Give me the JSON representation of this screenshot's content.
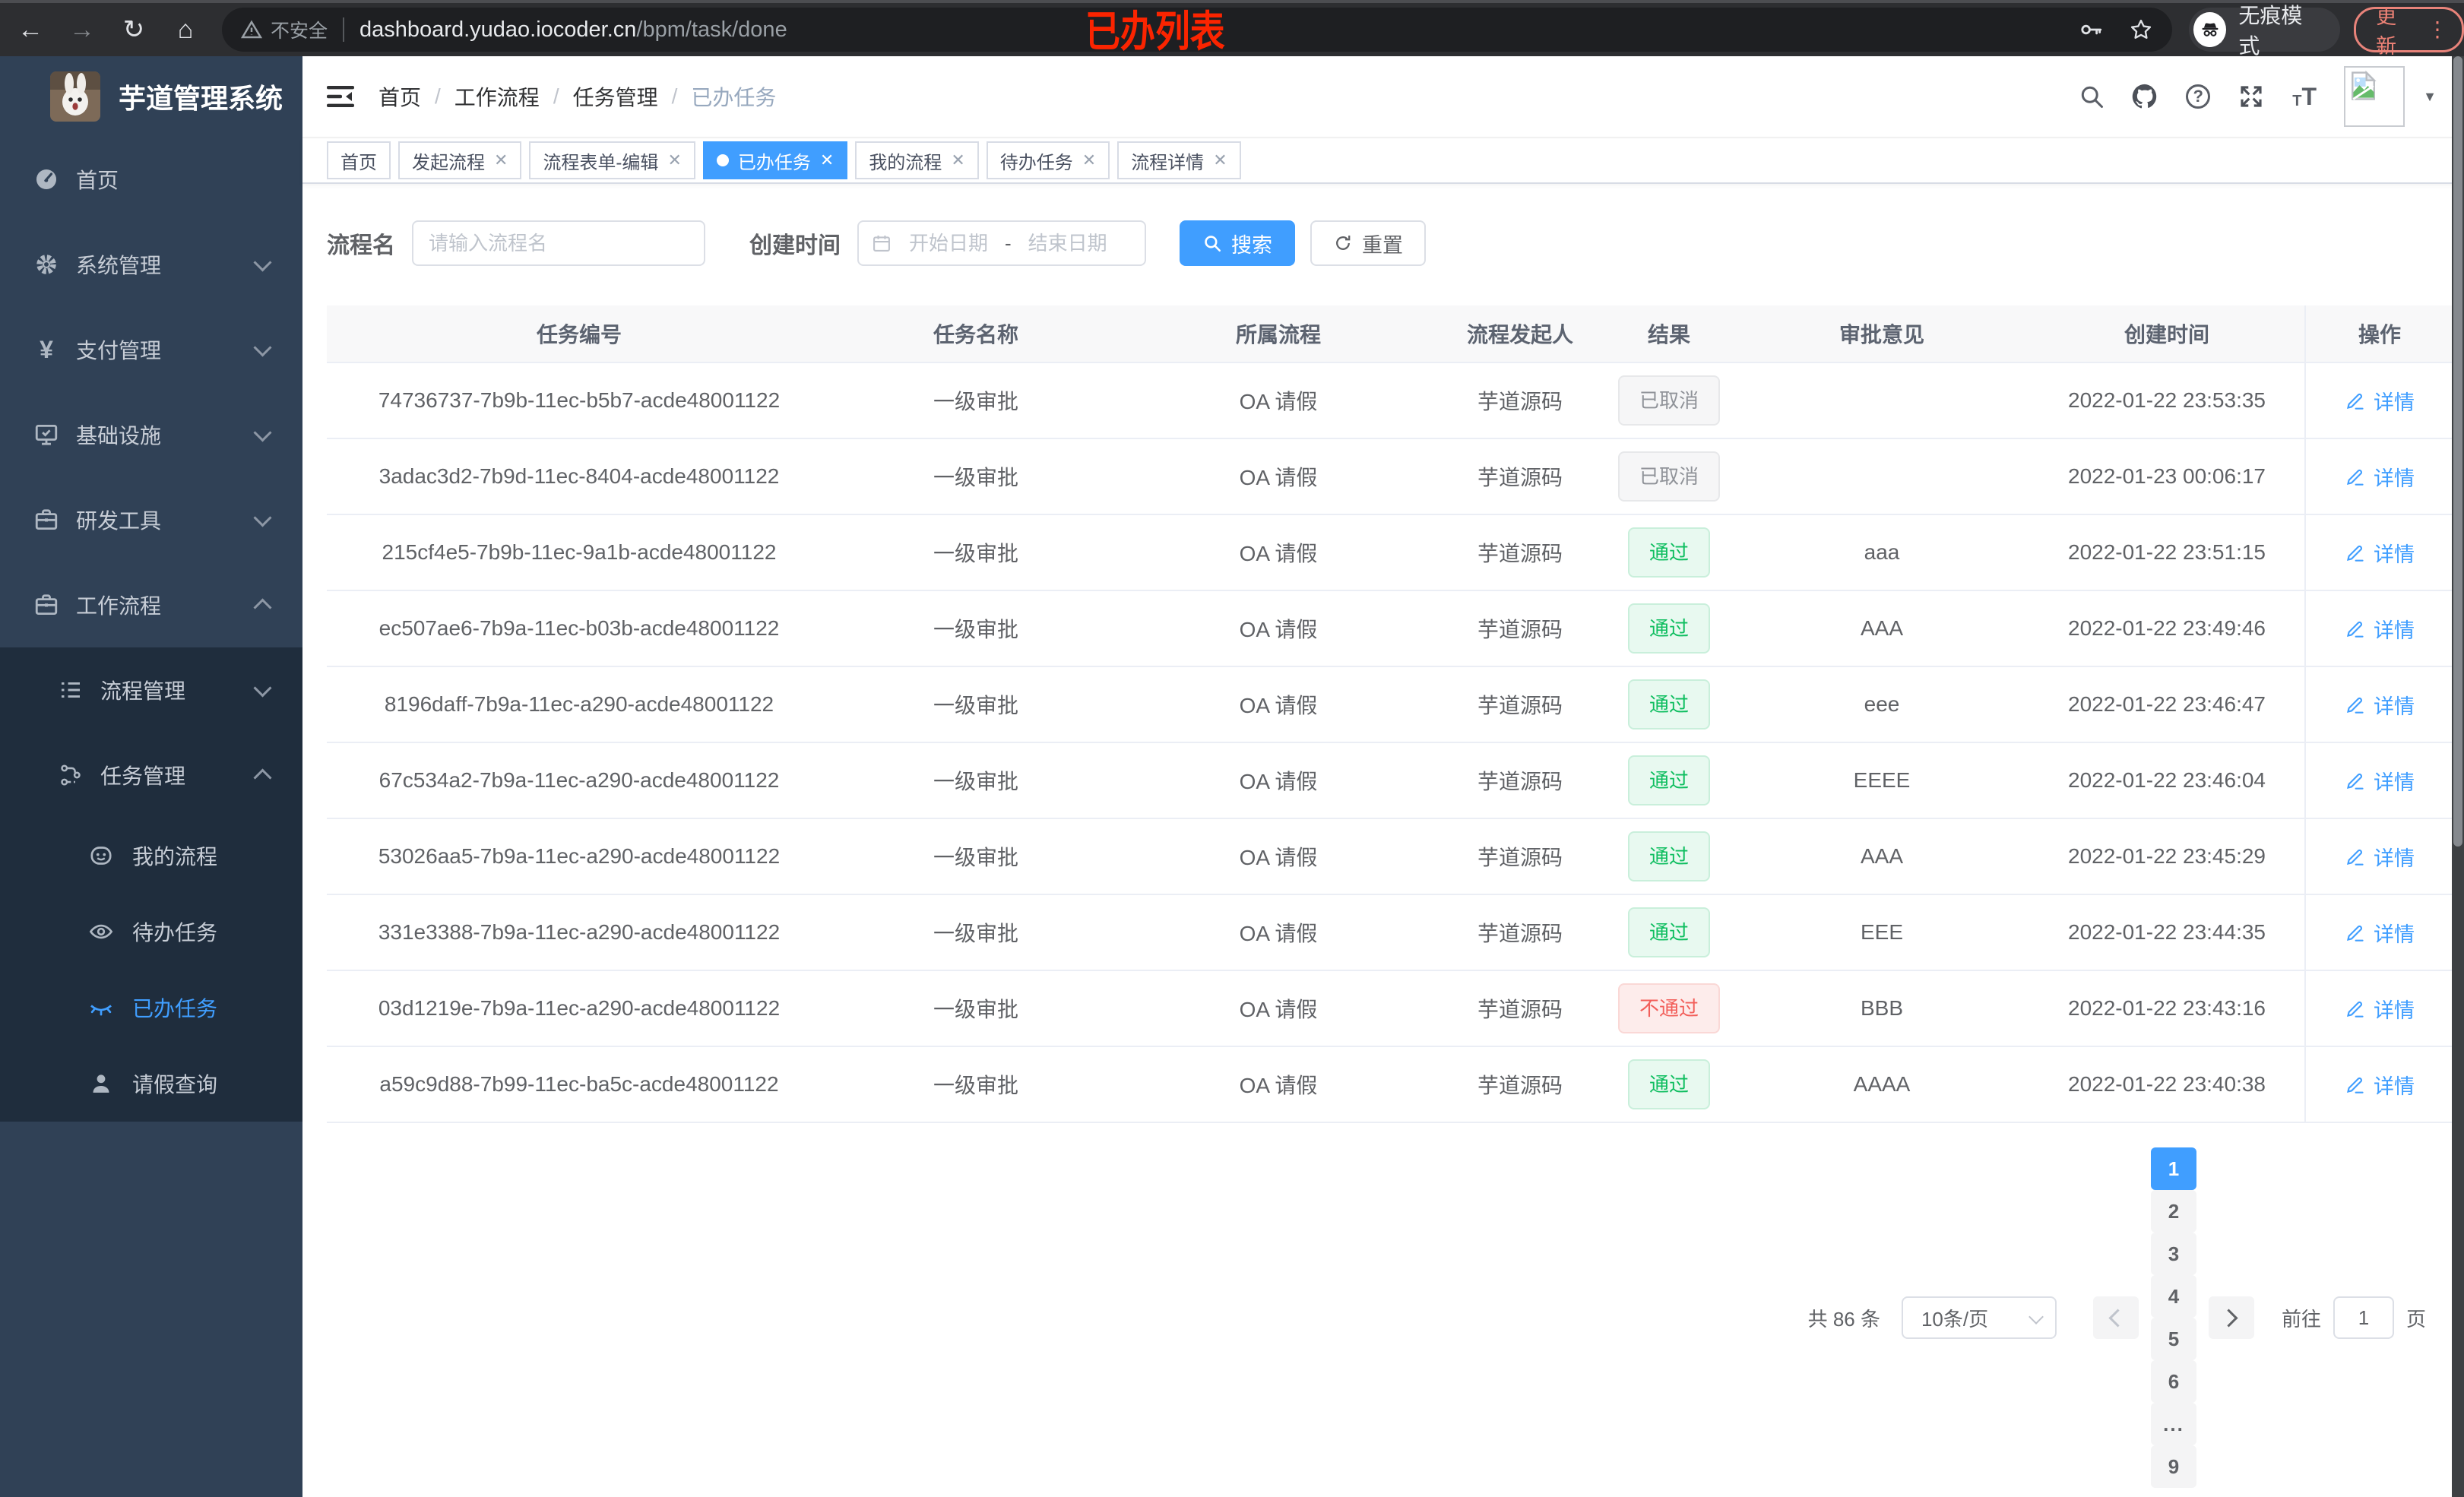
{
  "browser": {
    "secure_label": "不安全",
    "url_host": "dashboard.yudao.iocoder.cn",
    "url_path": "/bpm/task/done",
    "incognito_label": "无痕模式",
    "update_label": "更新"
  },
  "overlay": {
    "title": "已办列表",
    "color": "#fb2400"
  },
  "sidebar": {
    "app_title": "芋道管理系统",
    "menu": [
      {
        "label": "首页",
        "icon": "dashboard",
        "level": 1,
        "chevron": "",
        "active": false,
        "sub": false
      },
      {
        "label": "系统管理",
        "icon": "gear",
        "level": 1,
        "chevron": "down",
        "active": false,
        "sub": false
      },
      {
        "label": "支付管理",
        "icon": "yen",
        "level": 1,
        "chevron": "down",
        "active": false,
        "sub": false
      },
      {
        "label": "基础设施",
        "icon": "infra",
        "level": 1,
        "chevron": "down",
        "active": false,
        "sub": false
      },
      {
        "label": "研发工具",
        "icon": "toolbox",
        "level": 1,
        "chevron": "down",
        "active": false,
        "sub": false
      },
      {
        "label": "工作流程",
        "icon": "toolbox",
        "level": 1,
        "chevron": "up",
        "active": false,
        "sub": false
      },
      {
        "label": "流程管理",
        "icon": "list",
        "level": 2,
        "chevron": "down",
        "active": false,
        "sub": true
      },
      {
        "label": "任务管理",
        "icon": "flow",
        "level": 2,
        "chevron": "up",
        "active": false,
        "sub": true
      },
      {
        "label": "我的流程",
        "icon": "face",
        "level": 3,
        "chevron": "",
        "active": false,
        "sub": true
      },
      {
        "label": "待办任务",
        "icon": "eye",
        "level": 3,
        "chevron": "",
        "active": false,
        "sub": true
      },
      {
        "label": "已办任务",
        "icon": "eyeclosed",
        "level": 3,
        "chevron": "",
        "active": true,
        "sub": true
      },
      {
        "label": "请假查询",
        "icon": "user",
        "level": 3,
        "chevron": "",
        "active": false,
        "sub": true
      }
    ]
  },
  "header": {
    "breadcrumb": [
      "首页",
      "工作流程",
      "任务管理",
      "已办任务"
    ]
  },
  "tabs": [
    {
      "label": "首页",
      "closable": false,
      "active": false
    },
    {
      "label": "发起流程",
      "closable": true,
      "active": false
    },
    {
      "label": "流程表单-编辑",
      "closable": true,
      "active": false
    },
    {
      "label": "已办任务",
      "closable": true,
      "active": true
    },
    {
      "label": "我的流程",
      "closable": true,
      "active": false
    },
    {
      "label": "待办任务",
      "closable": true,
      "active": false
    },
    {
      "label": "流程详情",
      "closable": true,
      "active": false
    }
  ],
  "filters": {
    "name_label": "流程名",
    "name_placeholder": "请输入流程名",
    "date_label": "创建时间",
    "date_start_placeholder": "开始日期",
    "date_separator": "-",
    "date_end_placeholder": "结束日期",
    "search_label": "搜索",
    "reset_label": "重置"
  },
  "table": {
    "columns": [
      "任务编号",
      "任务名称",
      "所属流程",
      "流程发起人",
      "结果",
      "审批意见",
      "创建时间",
      "操作"
    ],
    "action_label": "详情",
    "rows": [
      {
        "id": "74736737-7b9b-11ec-b5b7-acde48001122",
        "name": "一级审批",
        "process": "OA 请假",
        "starter": "芋道源码",
        "result": "已取消",
        "result_type": "info",
        "opinion": "",
        "created": "2022-01-22 23:53:35"
      },
      {
        "id": "3adac3d2-7b9d-11ec-8404-acde48001122",
        "name": "一级审批",
        "process": "OA 请假",
        "starter": "芋道源码",
        "result": "已取消",
        "result_type": "info",
        "opinion": "",
        "created": "2022-01-23 00:06:17"
      },
      {
        "id": "215cf4e5-7b9b-11ec-9a1b-acde48001122",
        "name": "一级审批",
        "process": "OA 请假",
        "starter": "芋道源码",
        "result": "通过",
        "result_type": "success",
        "opinion": "aaa",
        "created": "2022-01-22 23:51:15"
      },
      {
        "id": "ec507ae6-7b9a-11ec-b03b-acde48001122",
        "name": "一级审批",
        "process": "OA 请假",
        "starter": "芋道源码",
        "result": "通过",
        "result_type": "success",
        "opinion": "AAA",
        "created": "2022-01-22 23:49:46"
      },
      {
        "id": "8196daff-7b9a-11ec-a290-acde48001122",
        "name": "一级审批",
        "process": "OA 请假",
        "starter": "芋道源码",
        "result": "通过",
        "result_type": "success",
        "opinion": "eee",
        "created": "2022-01-22 23:46:47"
      },
      {
        "id": "67c534a2-7b9a-11ec-a290-acde48001122",
        "name": "一级审批",
        "process": "OA 请假",
        "starter": "芋道源码",
        "result": "通过",
        "result_type": "success",
        "opinion": "EEEE",
        "created": "2022-01-22 23:46:04"
      },
      {
        "id": "53026aa5-7b9a-11ec-a290-acde48001122",
        "name": "一级审批",
        "process": "OA 请假",
        "starter": "芋道源码",
        "result": "通过",
        "result_type": "success",
        "opinion": "AAA",
        "created": "2022-01-22 23:45:29"
      },
      {
        "id": "331e3388-7b9a-11ec-a290-acde48001122",
        "name": "一级审批",
        "process": "OA 请假",
        "starter": "芋道源码",
        "result": "通过",
        "result_type": "success",
        "opinion": "EEE",
        "created": "2022-01-22 23:44:35"
      },
      {
        "id": "03d1219e-7b9a-11ec-a290-acde48001122",
        "name": "一级审批",
        "process": "OA 请假",
        "starter": "芋道源码",
        "result": "不通过",
        "result_type": "danger",
        "opinion": "BBB",
        "created": "2022-01-22 23:43:16"
      },
      {
        "id": "a59c9d88-7b99-11ec-ba5c-acde48001122",
        "name": "一级审批",
        "process": "OA 请假",
        "starter": "芋道源码",
        "result": "通过",
        "result_type": "success",
        "opinion": "AAAA",
        "created": "2022-01-22 23:40:38"
      }
    ]
  },
  "pagination": {
    "total_label": "共 86 条",
    "page_size_label": "10条/页",
    "pages": [
      "1",
      "2",
      "3",
      "4",
      "5",
      "6",
      "...",
      "9"
    ],
    "active_page": "1",
    "goto_label": "前往",
    "goto_value": "1",
    "page_unit": "页"
  },
  "colors": {
    "accent": "#409eff",
    "success": "#0fbe60",
    "danger": "#f25f5a",
    "info": "#909399",
    "sidebar_bg": "#304156",
    "submenu_bg": "#1f2d3d",
    "overlay_red": "#fb2400"
  }
}
